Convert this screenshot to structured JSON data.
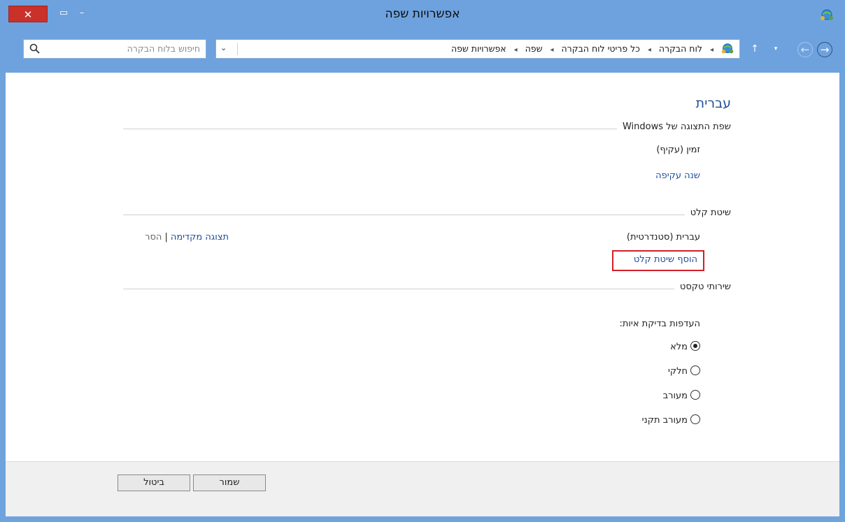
{
  "window": {
    "title": "אפשרויות שפה",
    "close_glyph": "✕",
    "maximize_glyph": "▭",
    "minimize_glyph": "–"
  },
  "navigation": {
    "forward_glyph": "→",
    "back_glyph": "←",
    "recent_glyph": "▾",
    "up_glyph": "↑"
  },
  "address": {
    "crumbs": [
      "לוח הבקרה",
      "כל פריטי לוח הבקרה",
      "שפה",
      "אפשרויות שפה"
    ],
    "dropdown_glyph": "⌄",
    "refresh_glyph": "↻"
  },
  "search": {
    "placeholder": "חיפוש בלוח הבקרה"
  },
  "main": {
    "heading": "עברית",
    "display_language": {
      "section_label": "שפת התצוגה של Windows",
      "value": "זמין (עקיף)",
      "link": "שנה עקיפה"
    },
    "input_method": {
      "section_label": "שיטת קלט",
      "name": "עברית (סטנדרטית)",
      "preview_link": "תצוגה מקדימה",
      "separator": "|",
      "remove_link": "הסר",
      "add_link": "הוסף שיטת קלט"
    },
    "text_services": {
      "section_label": "שירותי טקסט",
      "preference_label": "העדפות בדיקת איות:",
      "options": [
        "מלא",
        "חלקי",
        "מעורב",
        "מעורב תקני"
      ],
      "selected_index": 0
    }
  },
  "footer": {
    "save_label": "שמור",
    "cancel_label": "ביטול"
  },
  "icons": {
    "language_icon": "globe-people-icon",
    "search_icon": "magnifier"
  },
  "colors": {
    "title_bar": "#6ea2de",
    "close_button": "#c9312a",
    "link": "#1f4e9b",
    "highlight_box": "#d0202a"
  }
}
